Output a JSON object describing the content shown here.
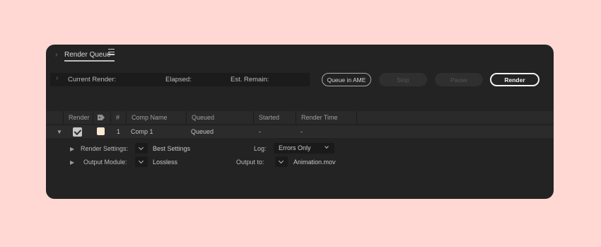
{
  "panel": {
    "tab_title": "Render Queue"
  },
  "status": {
    "current_render_label": "Current Render:",
    "elapsed_label": "Elapsed:",
    "est_remain_label": "Est. Remain:"
  },
  "buttons": {
    "queue_in_ame": "Queue in AME",
    "stop": "Stop",
    "pause": "Pause",
    "render": "Render"
  },
  "table": {
    "headers": {
      "render": "Render",
      "number": "#",
      "comp_name": "Comp Name",
      "status": "Queued",
      "started": "Started",
      "render_time": "Render Time"
    },
    "rows": [
      {
        "render_checked": true,
        "label_color": "#fde8d4",
        "number": "1",
        "comp_name": "Comp 1",
        "status": "Queued",
        "started": "-",
        "render_time": "-"
      }
    ]
  },
  "details": {
    "render_settings_label": "Render Settings:",
    "render_settings_value": "Best Settings",
    "log_label": "Log:",
    "log_value": "Errors Only",
    "output_module_label": "Output Module:",
    "output_module_value": "Lossless",
    "output_to_label": "Output to:",
    "output_to_value": "Animation.mov"
  },
  "colors": {
    "background": "#ffd8d4",
    "panel": "#232323",
    "accent_button_border": "#f2f2f2"
  }
}
